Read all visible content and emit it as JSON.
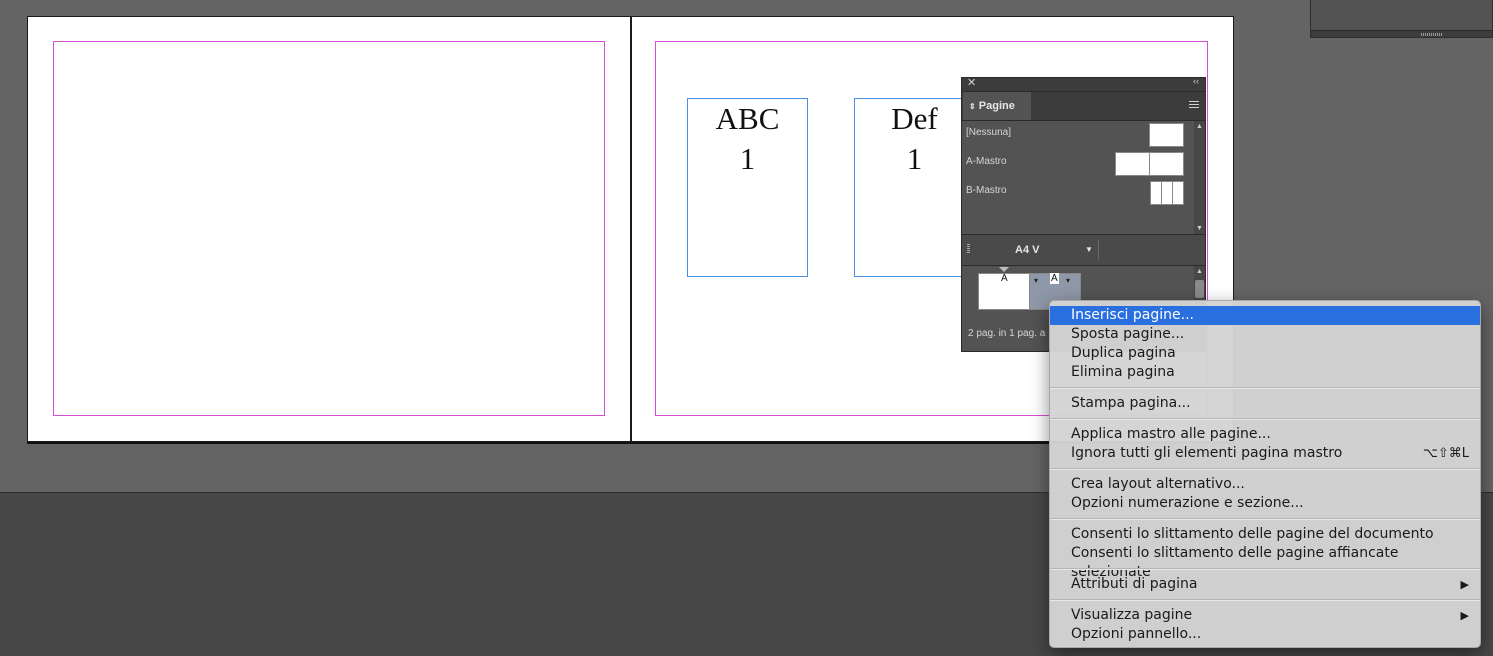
{
  "canvas": {
    "frames": [
      {
        "line1": "ABC",
        "line2": "1"
      },
      {
        "line1": "Def",
        "line2": "1"
      }
    ]
  },
  "pages_panel": {
    "close_glyph": "✕",
    "collapse_glyph": "‹‹",
    "tab_label": "Pagine",
    "masters": [
      "[Nessuna]",
      "A-Mastro",
      "B-Mastro"
    ],
    "page_size": "A4 V",
    "page_label_a": "A",
    "page_label_b": "A",
    "status": "2 pag. in 1 pag. a"
  },
  "context_menu": {
    "items": [
      {
        "label": "Inserisci pagine...",
        "highlighted": true
      },
      {
        "label": "Sposta pagine..."
      },
      {
        "label": "Duplica pagina"
      },
      {
        "label": "Elimina pagina"
      },
      {
        "label": "Stampa pagina..."
      },
      {
        "label": "Applica mastro alle pagine..."
      },
      {
        "label": "Ignora tutti gli elementi pagina mastro",
        "shortcut": "⌥⇧⌘L"
      },
      {
        "label": "Crea layout alternativo..."
      },
      {
        "label": "Opzioni numerazione e sezione..."
      },
      {
        "label": "Consenti lo slittamento delle pagine del documento"
      },
      {
        "label": "Consenti lo slittamento delle pagine affiancate selezionate"
      },
      {
        "label": "Attributi di pagina",
        "submenu": true
      },
      {
        "label": "Visualizza pagine",
        "submenu": true
      },
      {
        "label": "Opzioni pannello..."
      }
    ],
    "highlight_color": "#2a6fdf"
  }
}
